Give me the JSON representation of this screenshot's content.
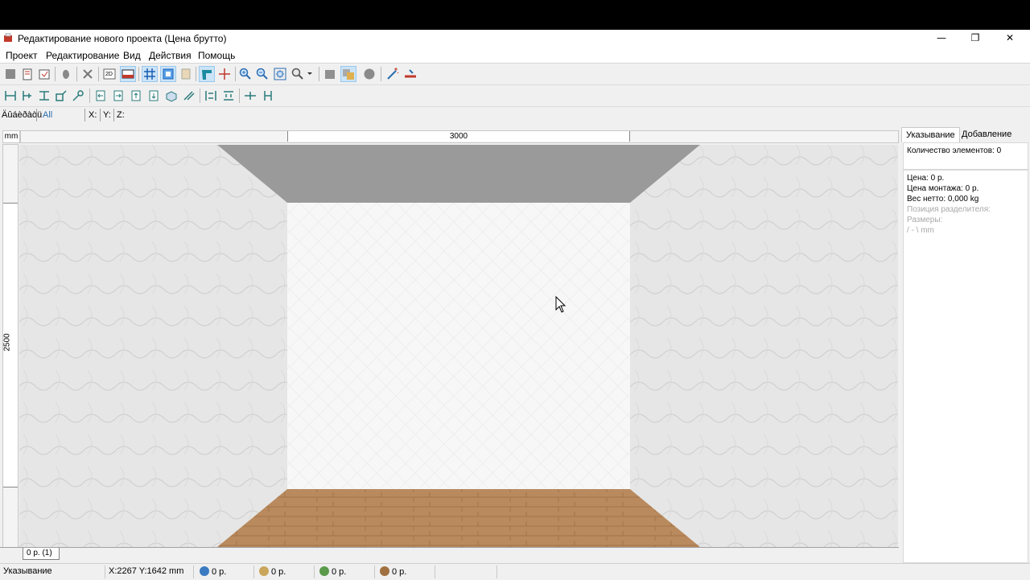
{
  "window": {
    "title": "Редактирование нового проекта (Цена брутто)",
    "controls": {
      "minimize": "—",
      "restore": "❐",
      "close": "✕"
    }
  },
  "menu": [
    "Проект",
    "Редактирование",
    "Вид",
    "Действия",
    "Помощь"
  ],
  "toolbar1": [
    {
      "icon": "stop-icon"
    },
    {
      "icon": "new-project-icon"
    },
    {
      "icon": "open-project-icon"
    },
    {
      "icon": "hand-icon"
    },
    {
      "icon": "delete-icon"
    },
    {
      "icon": "2d-view-icon",
      "label": "2D"
    },
    {
      "icon": "3d-view-icon",
      "pressed": true
    },
    {
      "icon": "grid-icon",
      "pressed": true
    },
    {
      "icon": "frame-icon",
      "pressed": true
    },
    {
      "icon": "wall-icon"
    },
    {
      "icon": "snap-icon",
      "pressed": true
    },
    {
      "icon": "crosshair-icon"
    },
    {
      "icon": "zoom-in-icon"
    },
    {
      "icon": "zoom-out-icon"
    },
    {
      "icon": "zoom-fit-icon"
    },
    {
      "icon": "zoom-dropdown-icon"
    },
    {
      "icon": "box-icon"
    },
    {
      "icon": "layers-icon",
      "pressed": true
    },
    {
      "icon": "sphere-icon"
    },
    {
      "icon": "magic-wand-icon"
    },
    {
      "icon": "measure-icon"
    }
  ],
  "toolbar2": [
    {
      "icon": "align-left-icon"
    },
    {
      "icon": "align-center-h-icon"
    },
    {
      "icon": "align-top-icon"
    },
    {
      "icon": "rotate-icon"
    },
    {
      "icon": "key-icon"
    },
    {
      "icon": "move-left-icon"
    },
    {
      "icon": "move-right-icon"
    },
    {
      "icon": "move-up-icon"
    },
    {
      "icon": "move-down-icon"
    },
    {
      "icon": "3d-rotate-icon"
    },
    {
      "icon": "mirror-icon"
    },
    {
      "icon": "distribute-h-icon"
    },
    {
      "icon": "distribute-v-icon"
    },
    {
      "icon": "spacing-h-icon"
    },
    {
      "icon": "spacing-v-icon"
    }
  ],
  "filterbar": {
    "label": "Äûáèðàòü",
    "filter": "All",
    "x": "X:",
    "y": "Y:",
    "z": "Z:"
  },
  "viewport": {
    "unit": "mm",
    "width_label": "3000",
    "height_label": "2500",
    "colors": {
      "ceiling": "#9a9a9a",
      "wall_back": "#f7f7f7",
      "wall_side": "#e6e6e6",
      "floor": "#b98a5e"
    }
  },
  "sheet_tab": "0 р. (1)",
  "right_panel": {
    "tabs": [
      "Указывание",
      "Добавление"
    ],
    "elements_count": "Количество элементов: 0",
    "price": "Цена:  0 р.",
    "install_price": "Цена монтажа:  0 р.",
    "net_weight": "Вес нетто:  0,000 kg",
    "divider_position": "Позиция разделителя:",
    "sizes": "Размеры:",
    "mm_line": "/ - \\ mm"
  },
  "status": {
    "mode": "Указывание",
    "coords": "X:2267  Y:1642  mm",
    "values": [
      "0 р.",
      "0 р.",
      "0 р.",
      "0 р."
    ]
  }
}
